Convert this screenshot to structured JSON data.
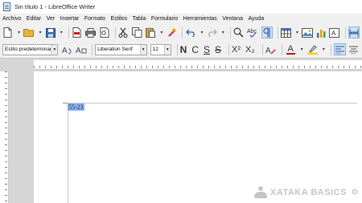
{
  "window": {
    "title": "Sin título 1 - LibreOffice Writer"
  },
  "menu": {
    "items": [
      {
        "label": "Archivo"
      },
      {
        "label": "Editar"
      },
      {
        "label": "Ver"
      },
      {
        "label": "Insertar"
      },
      {
        "label": "Formato"
      },
      {
        "label": "Estilos"
      },
      {
        "label": "Tabla"
      },
      {
        "label": "Formulario"
      },
      {
        "label": "Herramientas"
      },
      {
        "label": "Ventana"
      },
      {
        "label": "Ayuda"
      }
    ]
  },
  "standard_toolbar": {
    "icons": [
      "new-document-icon",
      "open-folder-icon",
      "save-icon",
      "export-pdf-icon",
      "print-icon",
      "print-preview-icon",
      "cut-icon",
      "copy-icon",
      "paste-icon",
      "clone-format-icon",
      "undo-icon",
      "redo-icon",
      "find-replace-icon",
      "spelling-icon",
      "formatting-marks-icon",
      "insert-table-icon",
      "insert-image-icon",
      "insert-chart-icon",
      "insert-textbox-icon",
      "page-break-icon"
    ]
  },
  "format_toolbar": {
    "paragraph_style": "Estilo predeterminado",
    "font_name": "Liberation Serif",
    "font_size": "12",
    "bold_label": "N",
    "italic_label": "C",
    "underline_label": "S",
    "strike_label": "S",
    "superscript_label": "X²",
    "subscript_label": "X₂",
    "font_color_label": "A",
    "colors": {
      "font_color": "#c00000",
      "highlight_color": "#ffd500",
      "active_button": "#cfe0f5"
    }
  },
  "document": {
    "typed_text": "55-23"
  },
  "watermark": {
    "text": "XATAKA BASICS"
  }
}
